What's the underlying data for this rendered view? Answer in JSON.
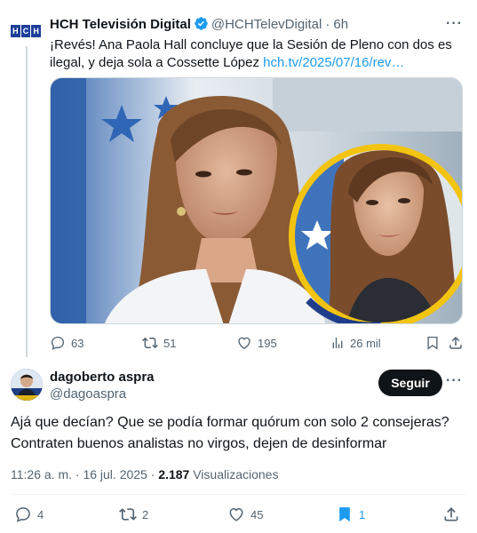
{
  "parent_tweet": {
    "logo_text": [
      "H",
      "C",
      "H"
    ],
    "author_name": "HCH Televisión Digital",
    "handle": "@HCHTelevDigital",
    "separator": "·",
    "time": "6h",
    "more": "···",
    "text": "¡Revés! Ana Paola Hall concluye que la Sesión de Pleno con dos es ilegal, y deja sola a Cossette López ",
    "link": "hch.tv/2025/07/16/rev…",
    "actions": {
      "replies": "63",
      "reposts": "51",
      "likes": "195",
      "views": "26 mil"
    }
  },
  "reply_tweet": {
    "author_name": "dagoberto aspra",
    "handle": "@dagoaspra",
    "follow_label": "Seguir",
    "more": "···",
    "text": "Ajá que decían? Que se podía formar quórum con solo 2 consejeras? Contraten buenos analistas no virgos, dejen de desinformar",
    "timestamp": "11:26 a. m. · 16 jul. 2025 · ",
    "views_count": "2.187",
    "views_label": " Visualizaciones",
    "actions": {
      "replies": "4",
      "reposts": "2",
      "likes": "45",
      "bookmarks": "1"
    }
  },
  "colors": {
    "link": "#1d9bf0",
    "muted": "#536471",
    "text": "#0f1419",
    "bookmark_active": "#1d9bf0"
  }
}
